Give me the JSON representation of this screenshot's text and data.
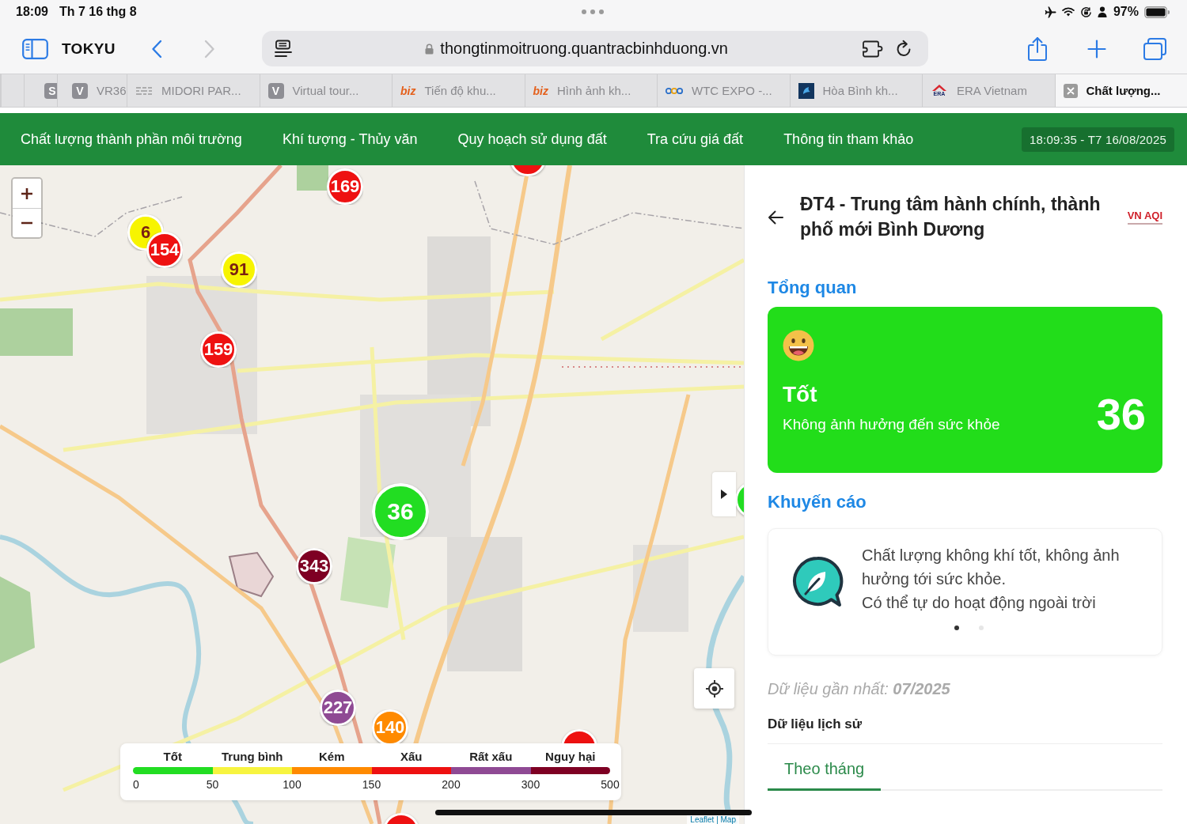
{
  "status_bar": {
    "time": "18:09",
    "date": "Th 7 16 thg 8",
    "battery": "97%"
  },
  "toolbar": {
    "tab_group": "TOKYU",
    "back": {
      "disabled": false
    },
    "forward": {
      "disabled": true
    },
    "url": "thongtinmoitruong.quantracbinhduong.vn"
  },
  "browser_tabs": [
    {
      "favicon": {
        "kind": "letter",
        "text": "S"
      },
      "selected": false
    },
    {
      "favicon": {
        "kind": "letter",
        "text": "V"
      },
      "title": "VR36",
      "selected": false
    },
    {
      "favicon": {
        "kind": "lines"
      },
      "title": "MIDORI PAR...",
      "selected": false
    },
    {
      "favicon": {
        "kind": "letter",
        "text": "V"
      },
      "title": "Virtual tour...",
      "selected": false
    },
    {
      "favicon": {
        "kind": "wordmark",
        "text": "biz"
      },
      "title": "Tiến độ khu...",
      "selected": false
    },
    {
      "favicon": {
        "kind": "wordmark",
        "text": "biz"
      },
      "title": "Hình ảnh kh...",
      "selected": false
    },
    {
      "favicon": {
        "kind": "rings"
      },
      "title": "WTC EXPO -...",
      "selected": false
    },
    {
      "favicon": {
        "kind": "tile"
      },
      "title": "Hòa Bình kh...",
      "selected": false
    },
    {
      "favicon": {
        "kind": "roof",
        "text": "ERA"
      },
      "title": "ERA Vietnam",
      "selected": false
    },
    {
      "title": "Chất lượng...",
      "selected": true
    }
  ],
  "site_nav": {
    "items": [
      "Chất lượng thành phần môi trường",
      "Khí tượng - Thủy văn",
      "Quy hoạch sử dụng đất",
      "Tra cứu giá đất",
      "Thông tin tham khảo"
    ],
    "datetime": "18:09:35 - T7 16/08/2025"
  },
  "map": {
    "markers": [
      {
        "color": "#ee1111",
        "selected": false
      },
      {
        "value": "169",
        "color": "#ee1111",
        "selected": false
      },
      {
        "value": "6",
        "color": "#f7f400",
        "selected": false
      },
      {
        "value": "154",
        "color": "#ee1111",
        "selected": false
      },
      {
        "value": "91",
        "color": "#f7f400",
        "selected": false
      },
      {
        "value": "159",
        "color": "#ee1111",
        "selected": false
      },
      {
        "value": "36",
        "color": "#22dd22",
        "selected": true
      },
      {
        "value": "343",
        "color": "#7e0023",
        "selected": false
      },
      {
        "value": "227",
        "color": "#8f4a94",
        "selected": false
      },
      {
        "value": "140",
        "color": "#ff8a00",
        "selected": false
      },
      {
        "color": "#ee1111",
        "selected": false
      },
      {
        "color": "#ee1111",
        "selected": false
      },
      {
        "color": "#22dd22",
        "selected": false
      }
    ],
    "legend": {
      "categories": [
        {
          "label": "Tốt",
          "color": "#22dd22"
        },
        {
          "label": "Trung bình",
          "color": "#f7f440"
        },
        {
          "label": "Kém",
          "color": "#ff8a00"
        },
        {
          "label": "Xấu",
          "color": "#ee1111"
        },
        {
          "label": "Rất xấu",
          "color": "#8f4a94"
        },
        {
          "label": "Nguy hại",
          "color": "#7e0023"
        }
      ],
      "ticks": [
        "0",
        "50",
        "100",
        "150",
        "200",
        "300",
        "500"
      ]
    },
    "attribution": "Leaflet | Map"
  },
  "panel": {
    "title": "ĐT4 - Trung tâm hành chính, thành phố mới Bình Dương",
    "logo": "VN AQI",
    "overview": {
      "heading": "Tổng quan",
      "status": "Tốt",
      "description": "Không ảnh hưởng đến sức khỏe",
      "aqi": "36"
    },
    "advice": {
      "heading": "Khuyến cáo",
      "lines": [
        "Chất lượng không khí tốt, không ảnh hưởng tới sức khỏe.",
        "Có thể tự do hoạt động ngoài trời"
      ],
      "dots": [
        {
          "selected": true
        },
        {
          "selected": false
        }
      ]
    },
    "latest": "Dữ liệu gần nhất: **07/2025**",
    "history": {
      "heading": "Dữ liệu lịch sử",
      "tabs": [
        {
          "label": "Theo tháng",
          "selected": true
        }
      ]
    }
  }
}
